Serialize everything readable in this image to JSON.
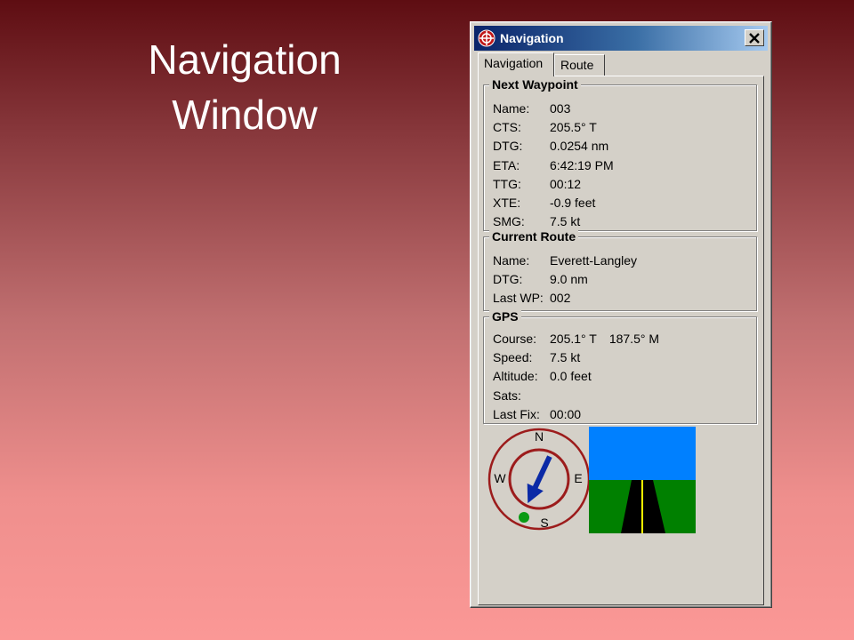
{
  "slide": {
    "title_line1": "Navigation",
    "title_line2": "Window"
  },
  "window": {
    "title": "Navigation",
    "close_label": "×"
  },
  "tabs": [
    {
      "label": "Navigation",
      "active": true
    },
    {
      "label": "Route",
      "active": false
    }
  ],
  "next_waypoint": {
    "heading": "Next Waypoint",
    "rows": [
      {
        "label": "Name:",
        "value": "003"
      },
      {
        "label": "CTS:",
        "value": "205.5° T"
      },
      {
        "label": "DTG:",
        "value": "0.0254 nm"
      },
      {
        "label": "ETA:",
        "value": "6:42:19 PM"
      },
      {
        "label": "TTG:",
        "value": "00:12"
      },
      {
        "label": "XTE:",
        "value": "-0.9 feet"
      },
      {
        "label": "SMG:",
        "value": "7.5 kt"
      }
    ]
  },
  "current_route": {
    "heading": "Current Route",
    "rows": [
      {
        "label": "Name:",
        "value": "Everett-Langley"
      },
      {
        "label": "DTG:",
        "value": "9.0 nm"
      },
      {
        "label": "Last WP:",
        "value": "002"
      }
    ]
  },
  "gps": {
    "heading": "GPS",
    "rows": [
      {
        "label": "Course:",
        "value": "205.1° T",
        "value2": "187.5° M"
      },
      {
        "label": "Speed:",
        "value": "7.5 kt"
      },
      {
        "label": "Altitude:",
        "value": "0.0 feet"
      },
      {
        "label": "Sats:",
        "value": ""
      },
      {
        "label": "Last Fix:",
        "value": "00:00"
      }
    ]
  },
  "compass": {
    "north": "N",
    "south": "S",
    "east": "E",
    "west": "W",
    "heading_degrees": 205.1,
    "ring_color": "#9c1c1c",
    "arrow_color": "#0b2aa6",
    "fix_dot_color": "#0a9a14"
  },
  "horizon": {
    "sky_color": "#0080ff",
    "ground_color": "#008000",
    "road_color": "#000000",
    "lane_color": "#ffff00"
  }
}
